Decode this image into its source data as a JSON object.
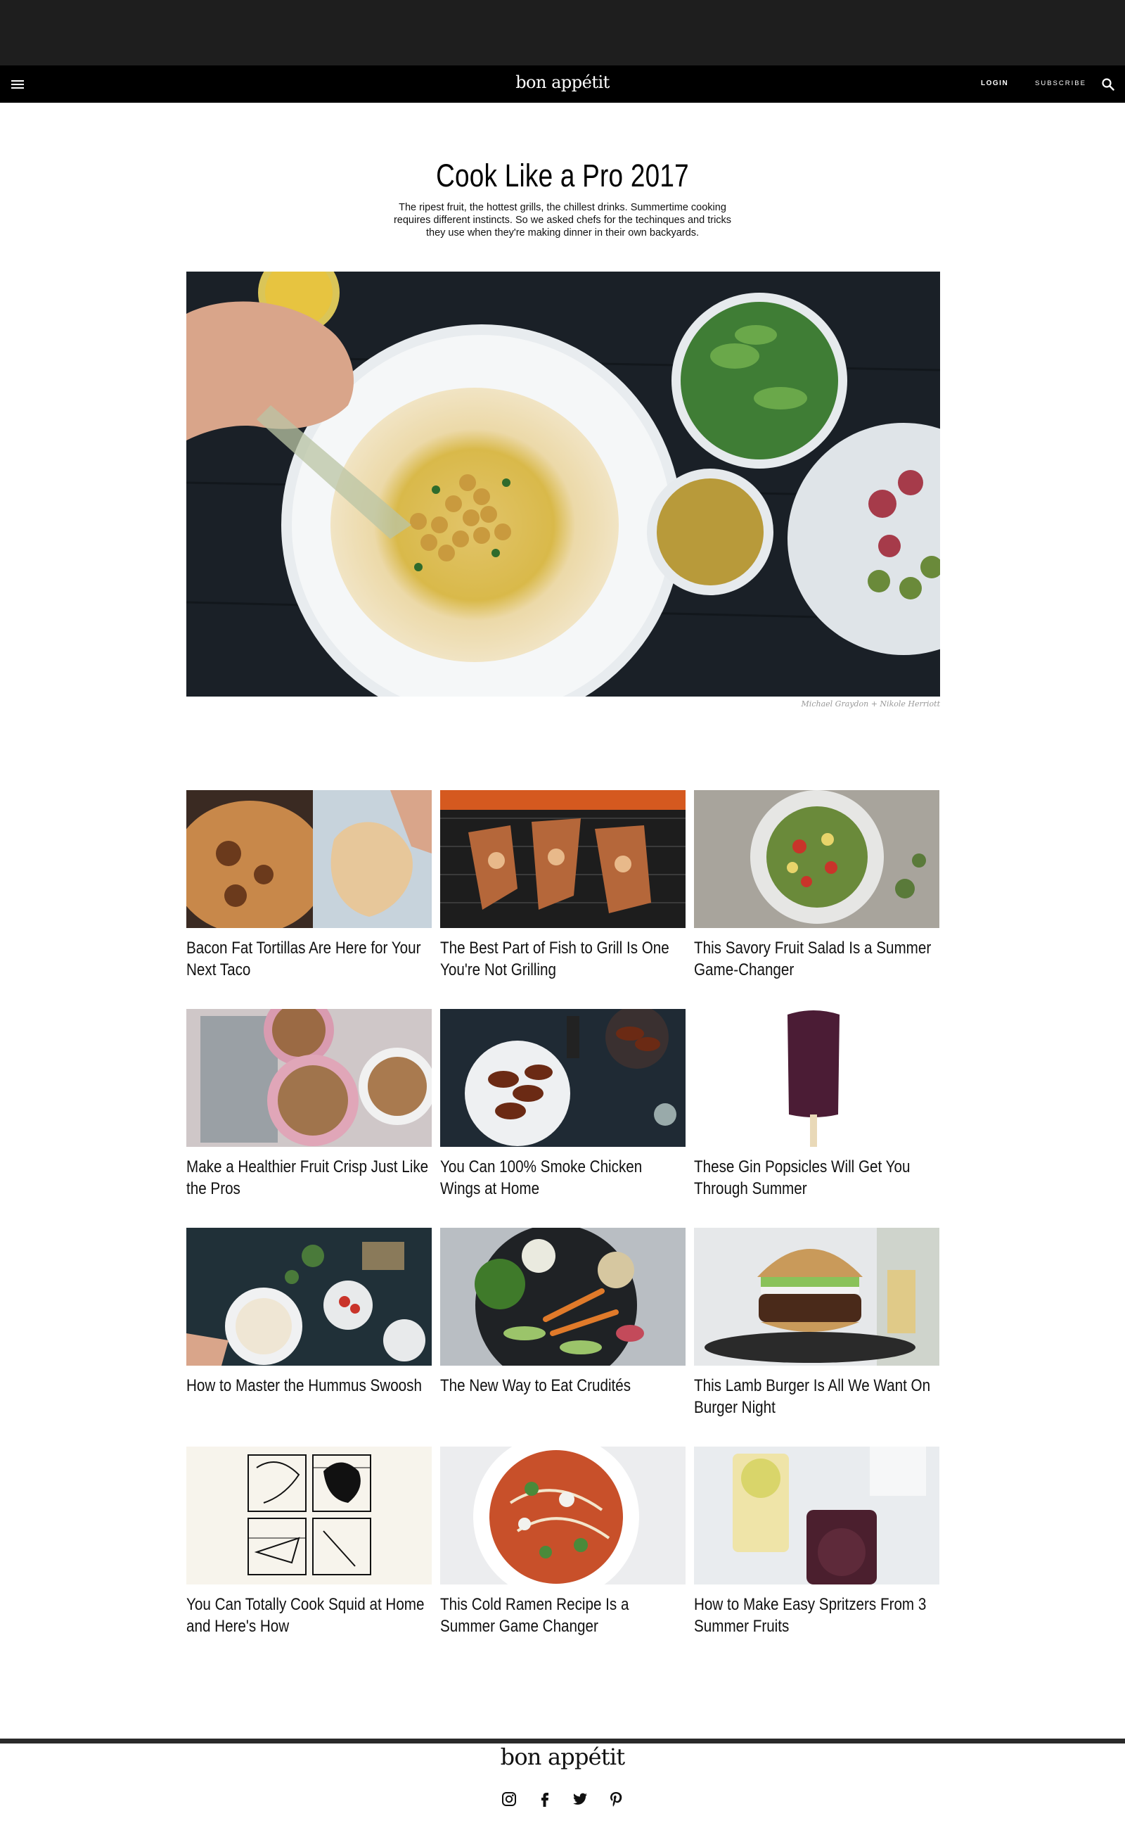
{
  "brand": {
    "name": "bon appétit"
  },
  "nav": {
    "menu_icon": "hamburger-menu-icon",
    "login_label": "LOGIN",
    "subscribe_label": "SUBSCRIBE",
    "search_icon": "search-icon"
  },
  "hero": {
    "title": "Cook Like a Pro 2017",
    "dek": "The ripest fruit, the hottest grills, the chillest drinks. Summertime cooking requires different instincts. So we asked chefs for the techinques and tricks they use when they're making dinner in their own backyards.",
    "image_alt": "Hummus drizzled with olive oil and chickpeas",
    "credit": "Michael Graydon + Nikole Herriott"
  },
  "cards": [
    {
      "title": "Bacon Fat Tortillas Are Here for Your Next Taco"
    },
    {
      "title": "The Best Part of Fish to Grill Is One You're Not Grilling"
    },
    {
      "title": "This Savory Fruit Salad Is a Summer Game-Changer"
    },
    {
      "title": "Make a Healthier Fruit Crisp Just Like the Pros"
    },
    {
      "title": "You Can 100% Smoke Chicken Wings at Home"
    },
    {
      "title": "These Gin Popsicles Will Get You Through Summer"
    },
    {
      "title": "How to Master the Hummus Swoosh"
    },
    {
      "title": "The New Way to Eat Crudités"
    },
    {
      "title": "This Lamb Burger Is All We Want On Burger Night"
    },
    {
      "title": "You Can Totally Cook Squid at Home and Here's How"
    },
    {
      "title": "This Cold Ramen Recipe Is a Summer Game Changer"
    },
    {
      "title": "How to Make Easy Spritzers From 3 Summer Fruits"
    }
  ],
  "footer": {
    "logo": "bon appétit",
    "social": [
      "instagram-icon",
      "facebook-icon",
      "twitter-icon",
      "pinterest-icon"
    ]
  }
}
